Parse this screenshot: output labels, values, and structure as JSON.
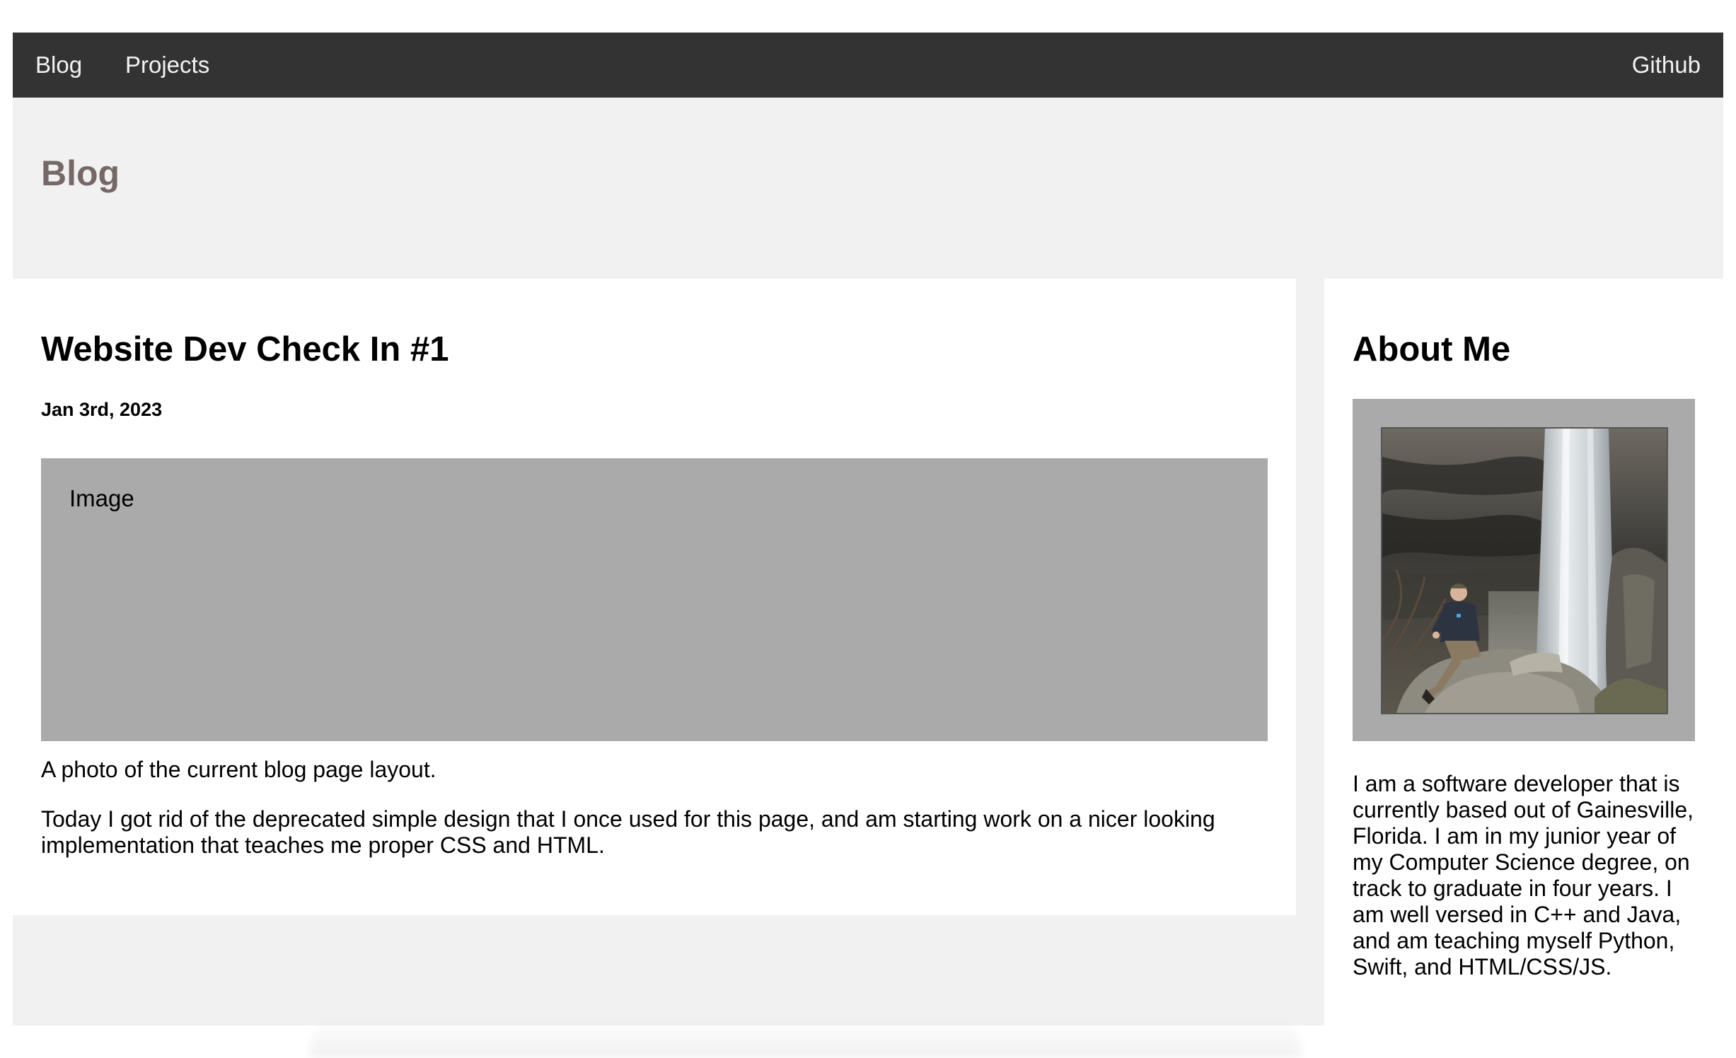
{
  "nav": {
    "blog_label": "Blog",
    "projects_label": "Projects",
    "github_label": "Github"
  },
  "header": {
    "title": "Blog"
  },
  "post": {
    "title": "Website Dev Check In #1",
    "date": "Jan 3rd, 2023",
    "image_placeholder": "Image",
    "caption": "A photo of the current blog page layout.",
    "body": "Today I got rid of the deprecated simple design that I once used for this page, and am starting work on a nicer looking implementation that teaches me proper CSS and HTML."
  },
  "about": {
    "title": "About Me",
    "photo_icon": "photo-waterfall-person",
    "text": "I am a software developer that is currently based out of Gainesville, Florida. I am in my junior year of my Computer Science degree, on track to graduate in four years. I am well versed in C++ and Java, and am teaching myself Python, Swift, and HTML/CSS/JS."
  },
  "colors": {
    "nav_bg": "#333333",
    "page_bg": "#f1f1f1",
    "page_title": "#776868",
    "image_placeholder_bg": "#aaaaaa"
  }
}
